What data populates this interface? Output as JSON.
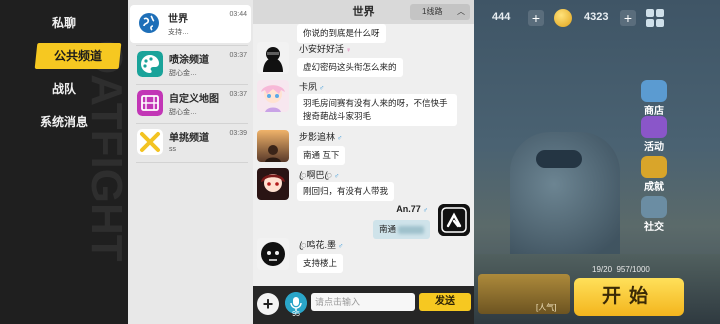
{
  "left_nav": {
    "items": [
      {
        "label": "私聊"
      },
      {
        "label": "公共频道"
      },
      {
        "label": "战队"
      },
      {
        "label": "系统消息"
      }
    ],
    "active_index": 1,
    "accent_color": "#f6c821"
  },
  "channels": [
    {
      "name": "世界",
      "time": "03:44",
      "preview": "支持…",
      "icon": "globe-icon",
      "color": "#1e6fb8"
    },
    {
      "name": "喷涂频道",
      "time": "03:37",
      "preview": "甜心金…",
      "icon": "palette-icon",
      "color": "#1aa39a"
    },
    {
      "name": "自定义地图",
      "time": "03:37",
      "preview": "甜心金…",
      "icon": "map-icon",
      "color": "#c236b6"
    },
    {
      "name": "单挑频道",
      "time": "03:39",
      "preview": "ss",
      "icon": "crossed-swords-icon",
      "color": "#f3c321"
    }
  ],
  "chat": {
    "title": "世界",
    "line_selector": "1线路",
    "messages": [
      {
        "sender": "",
        "gender": "",
        "text": "你说的到底是什么呀"
      },
      {
        "sender": "小安好好活",
        "gender": "♀",
        "text": "虚幻密码这头衔怎么来的"
      },
      {
        "sender": "卡夙",
        "gender": "♂",
        "text": "羽毛房间赛有没有人来的呀，不信快手搜奇葩战斗家羽毛"
      },
      {
        "sender": "步影追林",
        "gender": "♂",
        "text": "南通 互下"
      },
      {
        "sender": "ꦿ啊巴ꦿ",
        "gender": "♂",
        "text": "刚回归，有没有人带我"
      },
      {
        "sender": "An.77",
        "gender": "♂",
        "text": "南通"
      },
      {
        "sender": "ꦿ鸣花.墨",
        "gender": "♂",
        "text": "支持楼上"
      }
    ],
    "input_placeholder": "请点击输入",
    "send_label": "发送",
    "voice_count": "95"
  },
  "hud": {
    "diamonds": "444",
    "coins": "4323",
    "menu": [
      {
        "label": "商店",
        "icon": "shop-icon"
      },
      {
        "label": "活动",
        "icon": "event-icon"
      },
      {
        "label": "成就",
        "icon": "trophy-icon"
      },
      {
        "label": "社交",
        "icon": "social-icon"
      }
    ],
    "start_label": "开始",
    "level_info": "19/20",
    "level_exp": "957/1000",
    "card_label": "[人气]"
  }
}
